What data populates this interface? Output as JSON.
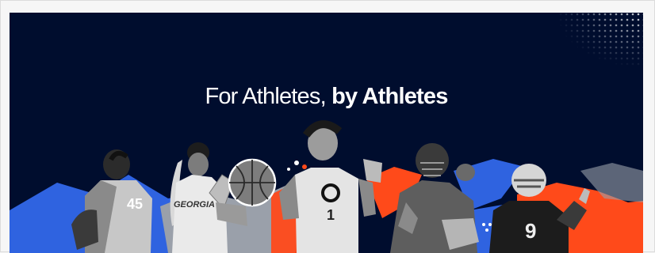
{
  "banner": {
    "headline_light": "For Athletes,",
    "headline_bold": "by Athletes",
    "background_color": "#000d2e",
    "accent_blue": "#2f63e0",
    "accent_orange": "#ff4a1a"
  },
  "jerseys": {
    "player_1": "45",
    "player_2": "GEORGIA",
    "player_3": "1",
    "player_5": "9"
  }
}
